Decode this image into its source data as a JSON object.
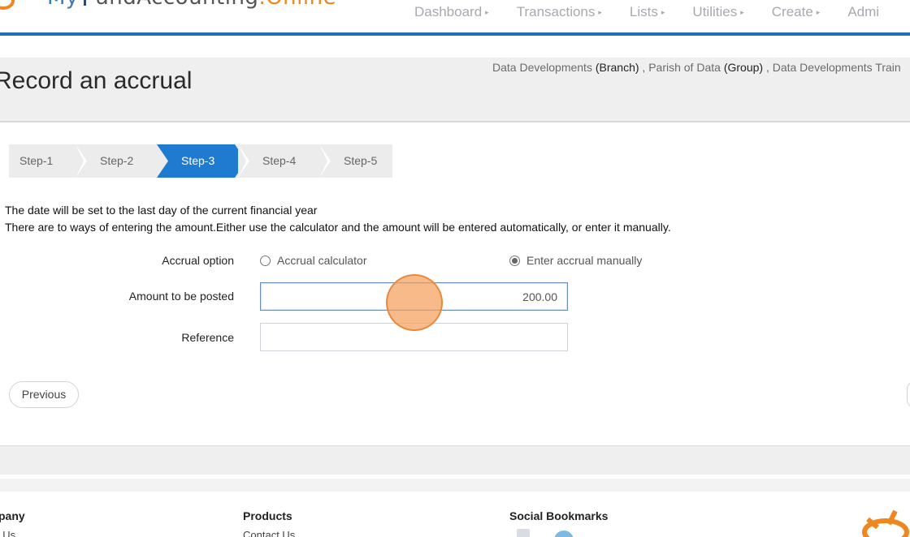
{
  "header": {
    "logo": {
      "part1": "My",
      "part2": "and",
      "part3": "Accounting",
      "part4": ".Online"
    },
    "nav": [
      {
        "label": "Dashboard"
      },
      {
        "label": "Transactions"
      },
      {
        "label": "Lists"
      },
      {
        "label": "Utilities"
      },
      {
        "label": "Create"
      },
      {
        "label": "Admi"
      }
    ]
  },
  "page": {
    "title": "Record an accrual",
    "breadcrumb": {
      "branch_name": "Data Developments",
      "branch_tag": "(Branch)",
      "group_name": "Parish of Data",
      "group_tag": "(Group)",
      "org_name": "Data Developments Train",
      "sep": ","
    }
  },
  "steps": [
    {
      "label": "Step-1"
    },
    {
      "label": "Step-2"
    },
    {
      "label": "Step-3",
      "active": true
    },
    {
      "label": "Step-4"
    },
    {
      "label": "Step-5"
    }
  ],
  "info": {
    "line1": "The date will be set to the last day of the current financial year",
    "line2": "There are to ways of entering the amount.Either use the calculator and the amount will be entered automatically, or enter it manually."
  },
  "form": {
    "accrual_option_label": "Accrual option",
    "option_calculator": "Accrual calculator",
    "option_manual": "Enter accrual manually",
    "selected_option": "Enter accrual manually",
    "amount_label": "Amount to be posted",
    "amount_value": "200.00",
    "reference_label": "Reference",
    "reference_value": ""
  },
  "buttons": {
    "previous": "Previous"
  },
  "footer": {
    "company_heading": "pany",
    "company_link": "t Us",
    "products_heading": "Products",
    "products_link": "Contact Us",
    "social_heading": "Social Bookmarks"
  },
  "colors": {
    "accent": "#1f7bd0",
    "header_rule": "#1f6fb5",
    "brand_orange": "#f0861f"
  }
}
